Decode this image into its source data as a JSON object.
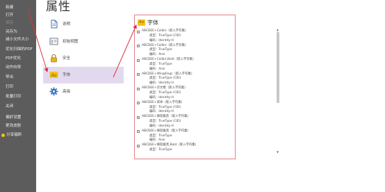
{
  "sidebar": {
    "items": [
      {
        "label": "新建",
        "disabled": false
      },
      {
        "label": "打开",
        "disabled": false
      },
      {
        "label": "保存",
        "disabled": true
      },
      {
        "label": "另存为",
        "disabled": false
      },
      {
        "label": "减小文件大小",
        "disabled": false
      },
      {
        "label": "优化扫描的PDF",
        "disabled": false
      },
      {
        "label": "PDF优化",
        "disabled": false
      },
      {
        "label": "动作向导",
        "disabled": false
      },
      {
        "label": "导出",
        "disabled": false
      },
      {
        "label": "打印",
        "disabled": false
      },
      {
        "label": "批量打印",
        "disabled": false
      },
      {
        "label": "关闭",
        "disabled": false
      },
      {
        "label": "偏好设置",
        "disabled": false
      },
      {
        "label": "更改皮肤",
        "disabled": false
      },
      {
        "label": "分享福昕",
        "disabled": false
      }
    ]
  },
  "page_title": "属性",
  "categories": [
    {
      "label": "说明",
      "icon": "document-icon",
      "active": false
    },
    {
      "label": "初始视图",
      "icon": "initial-view-icon",
      "active": false
    },
    {
      "label": "安全",
      "icon": "lock-icon",
      "active": false
    },
    {
      "label": "字体",
      "icon": "font-icon",
      "active": true
    },
    {
      "label": "高级",
      "icon": "gear-icon",
      "active": false
    }
  ],
  "font_panel": {
    "icon_text": "Aa",
    "title": "字体",
    "type_prefix": "类型：",
    "encoding_prefix": "编码：",
    "fonts": [
      {
        "name": "ABCDEE+Calibri（嵌入字符集）",
        "type": "TrueType (CID)",
        "encoding": "Identity-H"
      },
      {
        "name": "ABCDEE+Calibri（嵌入字符集）",
        "type": "TrueType",
        "encoding": "Ansi"
      },
      {
        "name": "ABCDEE+Calibri,Bold（嵌入字符集）",
        "type": "TrueType",
        "encoding": "Ansi"
      },
      {
        "name": "ABCDEE+Wingdings（嵌入字符集）",
        "type": "TrueType (CID)",
        "encoding": "Identity-H"
      },
      {
        "name": "ABCDEE+华文楷（嵌入字符集）",
        "type": "TrueType (CID)",
        "encoding": "Identity-H"
      },
      {
        "name": "ABCDEE+宋体（嵌入字符集）",
        "type": "TrueType (CID)",
        "encoding": "Identity-H"
      },
      {
        "name": "ABCDEE+微软雅黑（嵌入字符集）",
        "type": "TrueType (CID)",
        "encoding": "Identity-H"
      },
      {
        "name": "ABCDEE+微软雅黑（嵌入字符集）",
        "type": "TrueType",
        "encoding": "Ansi"
      },
      {
        "name": "ABCDEE+微软雅黑,Bold（嵌入字符集）",
        "type": "TrueType",
        "encoding": null
      }
    ]
  },
  "scrollbar": {
    "up_arrow": "▲",
    "down_arrow": "▼"
  },
  "colors": {
    "sidebar_bg": "#5c5c5c",
    "active_category_bg": "#e3d9ef",
    "panel_border": "#e57f86",
    "annotation_arrow": "#e0323c",
    "font_icon_bg": "#f2c21b"
  }
}
